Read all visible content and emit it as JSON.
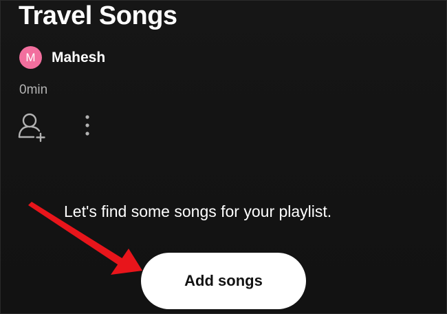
{
  "playlist": {
    "title": "Travel Songs",
    "duration": "0min"
  },
  "owner": {
    "avatar_initial": "M",
    "avatar_color": "#f26f9e",
    "name": "Mahesh"
  },
  "actions": {
    "add_collaborator_icon": "add-user-icon",
    "more_icon": "vertical-ellipsis-icon"
  },
  "empty_state": {
    "prompt": "Let's find some songs for your playlist.",
    "add_button_label": "Add songs"
  },
  "annotation": {
    "arrow_color": "#e8151b"
  }
}
